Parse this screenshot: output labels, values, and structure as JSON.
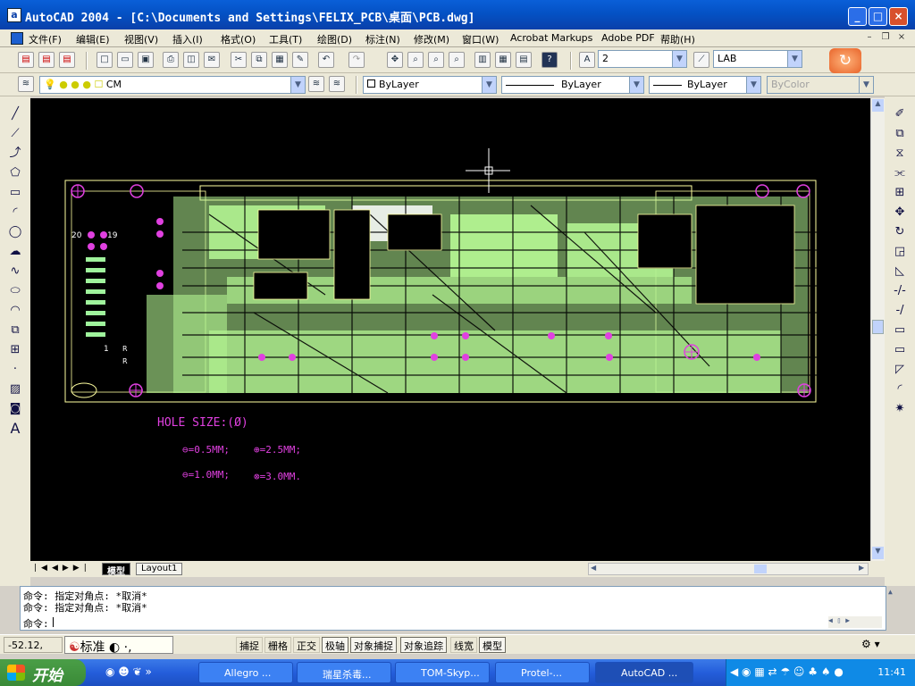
{
  "window": {
    "title": "AutoCAD 2004 - [C:\\Documents and Settings\\FELIX_PCB\\桌面\\PCB.dwg]",
    "app_icon": "a"
  },
  "menu": [
    "文件(F)",
    "编辑(E)",
    "视图(V)",
    "插入(I)",
    "格式(O)",
    "工具(T)",
    "绘图(D)",
    "标注(N)",
    "修改(M)",
    "窗口(W)",
    "Acrobat Markups",
    "Adobe PDF",
    "帮助(H)"
  ],
  "toolbar": {
    "text_height": "2",
    "text_style": "LAB"
  },
  "layers": {
    "current_layer": "CM",
    "color": "ByLayer",
    "linetype": "ByLayer",
    "lineweight": "ByLayer",
    "plot_style": "ByColor"
  },
  "drawing": {
    "board_labels": {
      "j1": "20",
      "j2": "19",
      "j3": "1",
      "r1": "R",
      "r2": "R"
    },
    "legend": {
      "title": "HOLE SIZE:(Ø)",
      "item1": "⊖=0.5MM;",
      "item2": "⊕=2.5MM;",
      "item3": "⊖=1.0MM;",
      "item4": "⊗=3.0MM."
    }
  },
  "layout_tabs": [
    "模型",
    "Layout1"
  ],
  "command": {
    "line1": "命令: 指定对角点: *取消*",
    "line2": "命令: 指定对角点: *取消*",
    "prompt": "命令:"
  },
  "status": {
    "coords": "-52.12,",
    "ime": "标准",
    "buttons": [
      "捕捉",
      "栅格",
      "正交",
      "极轴",
      "对象捕捉",
      "对象追踪",
      "线宽",
      "模型"
    ]
  },
  "taskbar": {
    "start": "开始",
    "tasks": [
      "Allegro ...",
      "瑞星杀毒...",
      "TOM-Skyp...",
      "Protel-...",
      "AutoCAD ..."
    ],
    "clock": "11:41"
  },
  "colors": {
    "pcb_trace": "#b3f391",
    "pcb_outline": "#ffffa0",
    "legend_magenta": "#e040e0",
    "canvas": "#000000"
  }
}
